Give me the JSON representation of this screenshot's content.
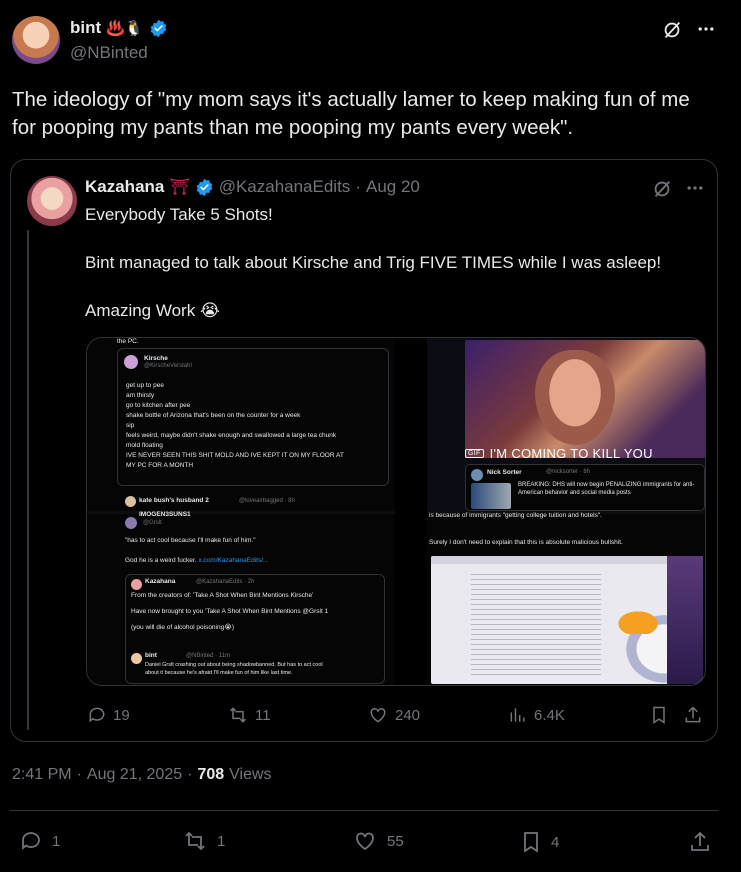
{
  "author": {
    "name": "bint",
    "emojis": "♨️🐧",
    "handle": "@NBinted"
  },
  "tweet_text": "The ideology of \"my mom says it's actually lamer to keep making fun of me for pooping my pants than me pooping my pants every week\".",
  "quote": {
    "name": "Kazahana",
    "emoji": "⛩",
    "handle": "@KazahanaEdits",
    "date": "Aug 20",
    "line1": "Everybody Take 5 Shots!",
    "line2": "Bint managed to talk about Kirsche and Trig FIVE TIMES while I was asleep!",
    "line3": "Amazing Work 😭",
    "stats": {
      "replies": "19",
      "retweets": "11",
      "likes": "240",
      "views": "6.4K"
    },
    "media": {
      "tl": {
        "top_fragment": "the PC.",
        "inner_name": "Kirsche",
        "inner_handle": "@KirscheVerstahl",
        "lines": [
          "get up to pee",
          "am thirsty",
          "go to kitchen after pee",
          "shake bottle of Arizona that's been on the counter for a week",
          "sip",
          "feels weird, maybe didn't shake enough and swallowed a large tea chunk",
          "mold floating",
          "IVE NEVER SEEN THIS SHIT MOLD AND IVE KEPT IT ON MY FLOOR AT",
          "MY PC FOR A MONTH"
        ],
        "footer_name": "kate bush's husband 2",
        "footer_handle": "@loveairbagged · 8h"
      },
      "tr": {
        "caption": "I'M COMING TO KILL YOU",
        "gif": "GIF",
        "nick_name": "Nick Sorter",
        "nick_handle": "@nicksorter · 8h",
        "nick_text": "BREAKING: DHS will now begin PENALIZING immigrants for anti-American behavior and social media posts"
      },
      "bl": {
        "top_name": "IMOGEN3SUNS1",
        "top_handle": "@Grslt",
        "quote1": "\"has to act cool because I'll make fun of him.\"",
        "quote2": "God he is a weird fucker.",
        "link": "x.com/KazahanaEdits/...",
        "k_name": "Kazahana",
        "k_handle": "@KazahanaEdits · 2h",
        "k_lines": [
          "From the creators of: 'Take A Shot When Bint Mentions Kirsche'",
          "Have now brought to you 'Take A Shot When Bint Mentions @Grslt 1",
          "(you will die of alcohol poisoning😭)"
        ],
        "b_name": "bint",
        "b_handle": "@NBinted · 11m",
        "b_lines": [
          "Daniel Grslt crashing out about being shadowbanned. But has to act cool",
          "about it because he's afraid I'll make fun of him like last time."
        ]
      },
      "br": {
        "line1": "is because of immigrants \"getting college tuition and hotels\".",
        "line2": "Surely I don't need to explain that this is absolute malicious bullshit."
      }
    }
  },
  "meta": {
    "time": "2:41 PM",
    "date": "Aug 21, 2025",
    "views_count": "708",
    "views_label": "Views"
  },
  "actions": {
    "replies": "1",
    "retweets": "1",
    "likes": "55",
    "bookmarks": "4"
  },
  "colors": {
    "accent": "#1d9bf0",
    "muted": "#71767b",
    "border": "#2f3336"
  }
}
